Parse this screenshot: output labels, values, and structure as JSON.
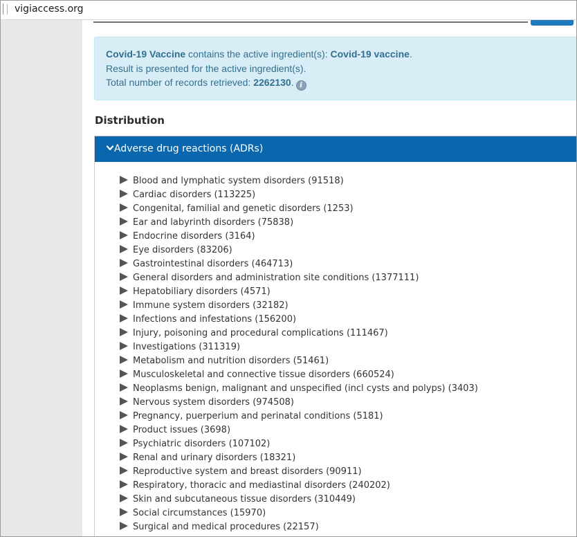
{
  "browser": {
    "url": "vigiaccess.org"
  },
  "info": {
    "drug_name": "Covid-19 Vaccine",
    "contains_text": " contains the active ingredient(s): ",
    "ingredient": "Covid-19 vaccine",
    "ingredient_suffix": ".",
    "result_line": "Result is presented for the active ingredient(s).",
    "total_label": "Total number of records retrieved: ",
    "total_value": "2262130",
    "total_suffix": ".",
    "info_icon": "info-icon"
  },
  "distribution": {
    "title": "Distribution",
    "panel_header": "Adverse drug reactions (ADRs)",
    "expanded": true,
    "items": [
      {
        "label": "Blood and lymphatic system disorders (91518)"
      },
      {
        "label": "Cardiac disorders (113225)"
      },
      {
        "label": "Congenital, familial and genetic disorders (1253)"
      },
      {
        "label": "Ear and labyrinth disorders (75838)"
      },
      {
        "label": "Endocrine disorders (3164)"
      },
      {
        "label": "Eye disorders (83206)"
      },
      {
        "label": "Gastrointestinal disorders (464713)"
      },
      {
        "label": "General disorders and administration site conditions (1377111)"
      },
      {
        "label": "Hepatobiliary disorders (4571)"
      },
      {
        "label": "Immune system disorders (32182)"
      },
      {
        "label": "Infections and infestations (156200)"
      },
      {
        "label": "Injury, poisoning and procedural complications (111467)"
      },
      {
        "label": "Investigations (311319)"
      },
      {
        "label": "Metabolism and nutrition disorders (51461)"
      },
      {
        "label": "Musculoskeletal and connective tissue disorders (660524)"
      },
      {
        "label": "Neoplasms benign, malignant and unspecified (incl cysts and polyps) (3403)"
      },
      {
        "label": "Nervous system disorders (974508)"
      },
      {
        "label": "Pregnancy, puerperium and perinatal conditions (5181)"
      },
      {
        "label": "Product issues (3698)"
      },
      {
        "label": "Psychiatric disorders (107102)"
      },
      {
        "label": "Renal and urinary disorders (18321)"
      },
      {
        "label": "Reproductive system and breast disorders (90911)"
      },
      {
        "label": "Respiratory, thoracic and mediastinal disorders (240202)"
      },
      {
        "label": "Skin and subcutaneous tissue disorders (310449)"
      },
      {
        "label": "Social circumstances (15970)"
      },
      {
        "label": "Surgical and medical procedures (22157)"
      }
    ]
  },
  "colors": {
    "panel_header_bg": "#0a67ad",
    "info_bg": "#d9edf7",
    "info_text": "#31708f"
  }
}
